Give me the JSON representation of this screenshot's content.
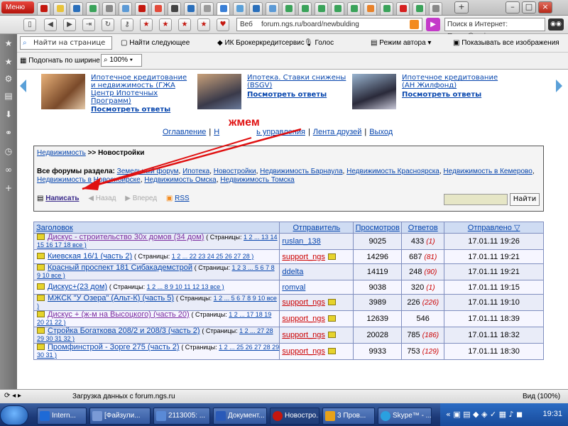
{
  "browser": {
    "menu_label": "Меню",
    "address": "forum.ngs.ru/board/newbulding",
    "address_label": "Веб",
    "search_placeholder": "Поиск в Интернет: Поиск@mai",
    "find_placeholder": "Найти на странице",
    "find_next": "Найти следующее",
    "bookmark1": "ИК Брокеркредитсервис",
    "voice": "Голос",
    "author_mode": "Режим автора",
    "show_images": "Показывать все изображения",
    "fit_width": "Подогнать по ширине",
    "zoom": "100%"
  },
  "ads": [
    {
      "text": "Ипотечное кредитование и недвижимость (ГЖА Центр Ипотечных Программ)",
      "answers": "Посмотреть ответы"
    },
    {
      "text": "Ипотека. Ставки снижены (BSGV)",
      "answers": "Посмотреть ответы"
    },
    {
      "text": "Ипотечное кредитование (АН Жилфонд)",
      "answers": "Посмотреть ответы"
    }
  ],
  "topnav": {
    "contents": "Оглавление",
    "h": "Н",
    "control": "ь управления",
    "friends": "Лента друзей",
    "exit": "Выход"
  },
  "annotation": "жмем",
  "forum": {
    "crumb_root": "Недвижимость",
    "crumb_sep": ">>",
    "crumb_current": "Новостройки",
    "section_label": "Все форумы раздела:",
    "sections": [
      "Земельный форум",
      "Ипотека",
      "Новостройки",
      "Недвижимость Барнаула",
      "Недвижимость Красноярска",
      "Недвижимость в Кемерово",
      "Недвижимость в Новосибирске",
      "Недвижимость Омска",
      "Недвижимость Томска"
    ],
    "write": "Написать",
    "back": "Назад",
    "forward": "Вперед",
    "rss": "RSS",
    "search_btn": "Найти"
  },
  "table": {
    "headers": [
      "Заголовок",
      "Отправитель",
      "Просмотров",
      "Ответов",
      "Отправлено"
    ],
    "rows": [
      {
        "title": "Дискус - строительство 30х домов (34 дом)",
        "pages_prefix": "( Страницы: ",
        "pages": "1 2 ... 13 14 15 16 17 18 все )",
        "sender": "ruslan_138",
        "views": "9025",
        "replies": "433",
        "new": "(1)",
        "date": "17.01.11 19:26"
      },
      {
        "title": "Киевская 16/1 (часть 2)",
        "pages_prefix": "( Страницы: ",
        "pages": "1 2 ... 22 23 24 25 26 27 28 )",
        "sender": "support_ngs",
        "views": "14296",
        "replies": "687",
        "new": "(81)",
        "date": "17.01.11 19:21"
      },
      {
        "title": "Красный проспект 181 Сибакадемстрой",
        "pages_prefix": "( Страницы: ",
        "pages": "1 2 3 ... 5 6 7 8 9 10 все )",
        "sender": "ddelta",
        "views": "14119",
        "replies": "248",
        "new": "(90)",
        "date": "17.01.11 19:21"
      },
      {
        "title": "Дискус+(23 дом)",
        "pages_prefix": "( Страницы: ",
        "pages": "1 2 ... 8 9 10 11 12 13 все )",
        "sender": "romval",
        "views": "9038",
        "replies": "320",
        "new": "(1)",
        "date": "17.01.11 19:15"
      },
      {
        "title": "МЖСК \"У Озера\" (Альт-К) (часть 5)",
        "pages_prefix": "( Страницы: ",
        "pages": "1 2 ... 5 6 7 8 9 10 все )",
        "sender": "support_ngs",
        "views": "3989",
        "replies": "226",
        "new": "(226)",
        "date": "17.01.11 19:10"
      },
      {
        "title": "Дискус + (ж-м на Высоцкого) (часть 20)",
        "pages_prefix": "( Страницы: ",
        "pages": "1 2 ... 17 18 19 20 21 22 )",
        "sender": "support_ngs",
        "views": "12639",
        "replies": "546",
        "new": "",
        "date": "17.01.11 18:39"
      },
      {
        "title": "Стройка Богаткова 208/2 и 208/3 (часть 2)",
        "pages_prefix": "( Страницы: ",
        "pages": "1 2 ... 27 28 29 30 31 32 )",
        "sender": "support_ngs",
        "views": "20028",
        "replies": "785",
        "new": "(186)",
        "date": "17.01.11 18:32"
      },
      {
        "title": "Промфинстрой - Зорге 275 (часть 2)",
        "pages_prefix": "( Страницы: ",
        "pages": "1 2 ... 25 26 27 28 29 30 31 )",
        "sender": "support_ngs",
        "views": "9933",
        "replies": "753",
        "new": "(129)",
        "date": "17.01.11 18:30"
      }
    ]
  },
  "status": {
    "text": "Загрузка данных с forum.ngs.ru",
    "zoom": "Вид (100%)"
  },
  "taskbar": {
    "items": [
      "Intern...",
      "[Файзули...",
      "2113005: ...",
      "Документ...",
      "Новостро...",
      "3 Пров...",
      "Skype™ - ..."
    ],
    "clock": "19:31"
  },
  "colors": {
    "menu_red": "#c4170e",
    "link": "#0645ad",
    "header_bg": "#cfdcf3",
    "annotation": "#e01010",
    "new_replies": "#cc0000"
  }
}
